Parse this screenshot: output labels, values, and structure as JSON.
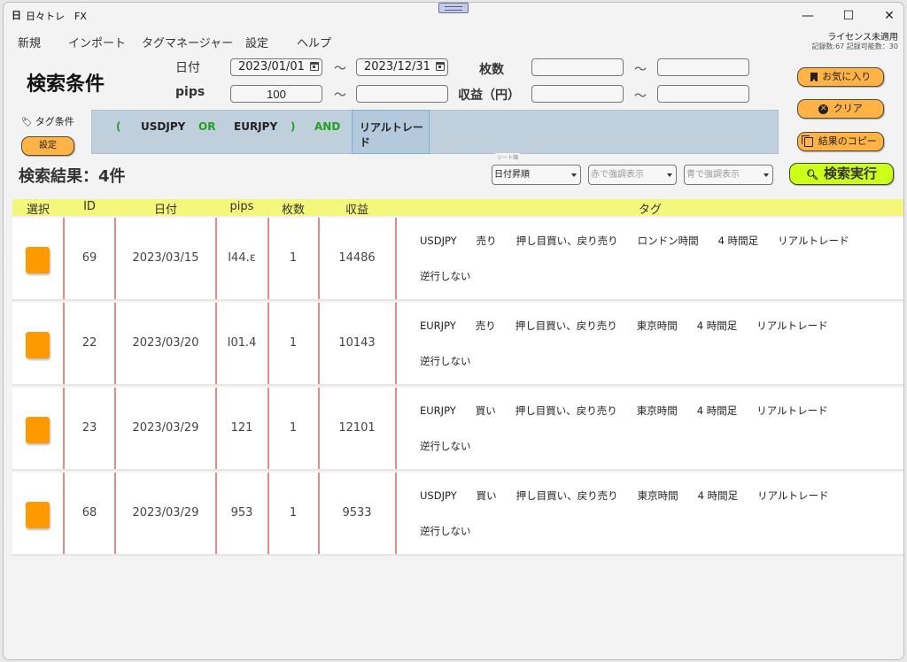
{
  "window": {
    "title": "日々トレ　FX",
    "controls": {
      "minimize": "—",
      "maximize": "☐",
      "close": "✕"
    }
  },
  "menu": {
    "items": [
      "新規",
      "インポート",
      "タグマネージャー",
      "設定",
      "ヘルプ"
    ]
  },
  "status": {
    "license": "ライセンス未適用",
    "records": "記録数:67 記録可能数：30"
  },
  "search": {
    "title": "検索条件",
    "date_label": "日付",
    "date_from": "2023/01/01",
    "date_to": "2023/12/31",
    "pips_label": "pips",
    "pips_from": "100",
    "pips_to": "",
    "lots_label": "枚数",
    "lots_from": "",
    "lots_to": "",
    "profit_label": "収益（円）",
    "profit_from": "",
    "profit_to": "",
    "range_sep": "～"
  },
  "buttons": {
    "favorite": "お気に入り",
    "clear": "クリア",
    "copy_results": "結果のコピー",
    "execute": "検索実行",
    "tag_settings": "設定"
  },
  "tag_condition": {
    "label": "タグ条件",
    "tokens": [
      {
        "text": "(",
        "type": "op"
      },
      {
        "text": "USDJPY",
        "type": "tag"
      },
      {
        "text": "OR",
        "type": "op"
      },
      {
        "text": "EURJPY",
        "type": "tag"
      },
      {
        "text": ")",
        "type": "op"
      },
      {
        "text": "AND",
        "type": "op"
      },
      {
        "text": "リアルトレード",
        "type": "tag-selected"
      }
    ]
  },
  "results": {
    "title": "検索結果：4件",
    "sort_caption": "ソート順",
    "sort_value": "日付昇順",
    "red_highlight_placeholder": "赤で強調表示",
    "blue_highlight_placeholder": "青で強調表示"
  },
  "table": {
    "columns": [
      "選択",
      "ID",
      "日付",
      "pips",
      "枚数",
      "収益",
      "タグ"
    ],
    "rows": [
      {
        "id": "69",
        "date": "2023/03/15",
        "pips": "144.8",
        "pips_display": "I44.ε",
        "lots": "1",
        "profit": "14486",
        "tags": [
          "USDJPY",
          "売り",
          "押し目買い、戻り売り",
          "ロンドン時間",
          "4 時間足",
          "リアルトレード"
        ],
        "tags_line2": "逆行しない"
      },
      {
        "id": "22",
        "date": "2023/03/20",
        "pips": "101.4",
        "pips_display": "I01.4",
        "lots": "1",
        "profit": "10143",
        "tags": [
          "EURJPY",
          "売り",
          "押し目買い、戻り売り",
          "東京時間",
          "4 時間足",
          "リアルトレード"
        ],
        "tags_line2": "逆行しない"
      },
      {
        "id": "23",
        "date": "2023/03/29",
        "pips": "121",
        "pips_display": "121",
        "lots": "1",
        "profit": "12101",
        "tags": [
          "EURJPY",
          "買い",
          "押し目買い、戻り売り",
          "東京時間",
          "4 時間足",
          "リアルトレード"
        ],
        "tags_line2": "逆行しない"
      },
      {
        "id": "68",
        "date": "2023/03/29",
        "pips": "953",
        "pips_display": "953",
        "lots": "1",
        "profit": "9533",
        "tags": [
          "USDJPY",
          "買い",
          "押し目買い、戻り売り",
          "東京時間",
          "4 時間足",
          "リアルトレード"
        ],
        "tags_line2": "逆行しない"
      }
    ]
  },
  "colors": {
    "accent_orange": "#ffb347",
    "select_box": "#ff9900",
    "execute_button": "#ccff1a",
    "table_header": "#f4f77a",
    "tag_area": "#c0cfdc",
    "operator_green": "#22a022",
    "column_divider": "#e88888"
  }
}
